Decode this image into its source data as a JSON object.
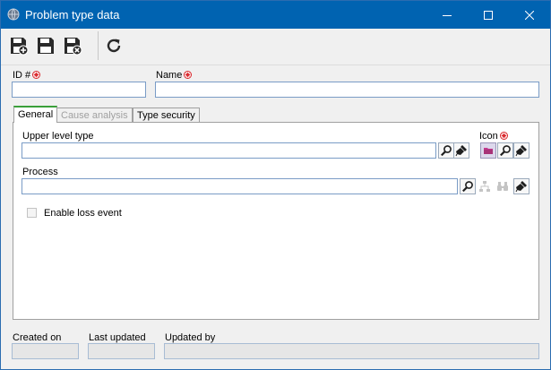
{
  "window": {
    "title": "Problem type data",
    "title_icon": "globe-icon",
    "controls": [
      "minimize-icon",
      "maximize-icon",
      "close-icon"
    ]
  },
  "toolbar": {
    "buttons": [
      "save-new-icon",
      "save-icon",
      "save-close-icon",
      "refresh-icon"
    ]
  },
  "form": {
    "id_label": "ID #",
    "id_value": "",
    "name_label": "Name",
    "name_value": ""
  },
  "tabs": [
    {
      "label": "General",
      "state": "active"
    },
    {
      "label": "Cause analysis",
      "state": "disabled"
    },
    {
      "label": "Type security",
      "state": "normal"
    }
  ],
  "general": {
    "upper_level_type_label": "Upper level type",
    "upper_level_type_value": "",
    "icon_label": "Icon",
    "process_label": "Process",
    "process_value": "",
    "enable_loss_event_label": "Enable loss event",
    "enable_loss_event_checked": false
  },
  "footer": {
    "created_on_label": "Created on",
    "created_on_value": "",
    "last_updated_label": "Last updated",
    "last_updated_value": "",
    "updated_by_label": "Updated by",
    "updated_by_value": ""
  },
  "colors": {
    "titlebar": "#0063b1",
    "required": "#d9252a",
    "active_tab_accent": "#3aa03a",
    "input_border": "#7a9cc6"
  }
}
